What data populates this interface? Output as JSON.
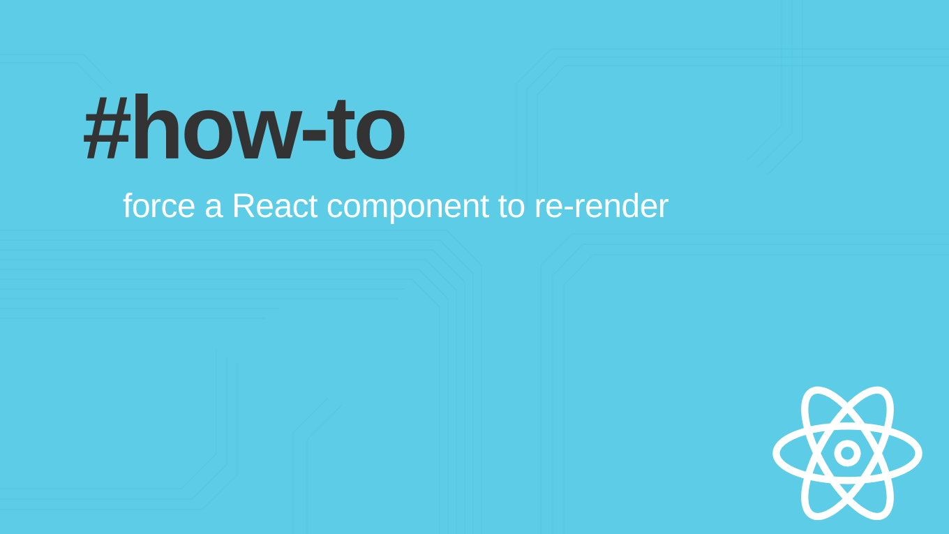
{
  "hero": {
    "hashtag": "#how-to",
    "subtitle": "force a React component to re-render"
  },
  "colors": {
    "background": "#5dcde7",
    "hashtag": "#333333",
    "subtitle": "#ffffff",
    "logo": "#ffffff"
  },
  "logo": {
    "name": "react-logo"
  }
}
